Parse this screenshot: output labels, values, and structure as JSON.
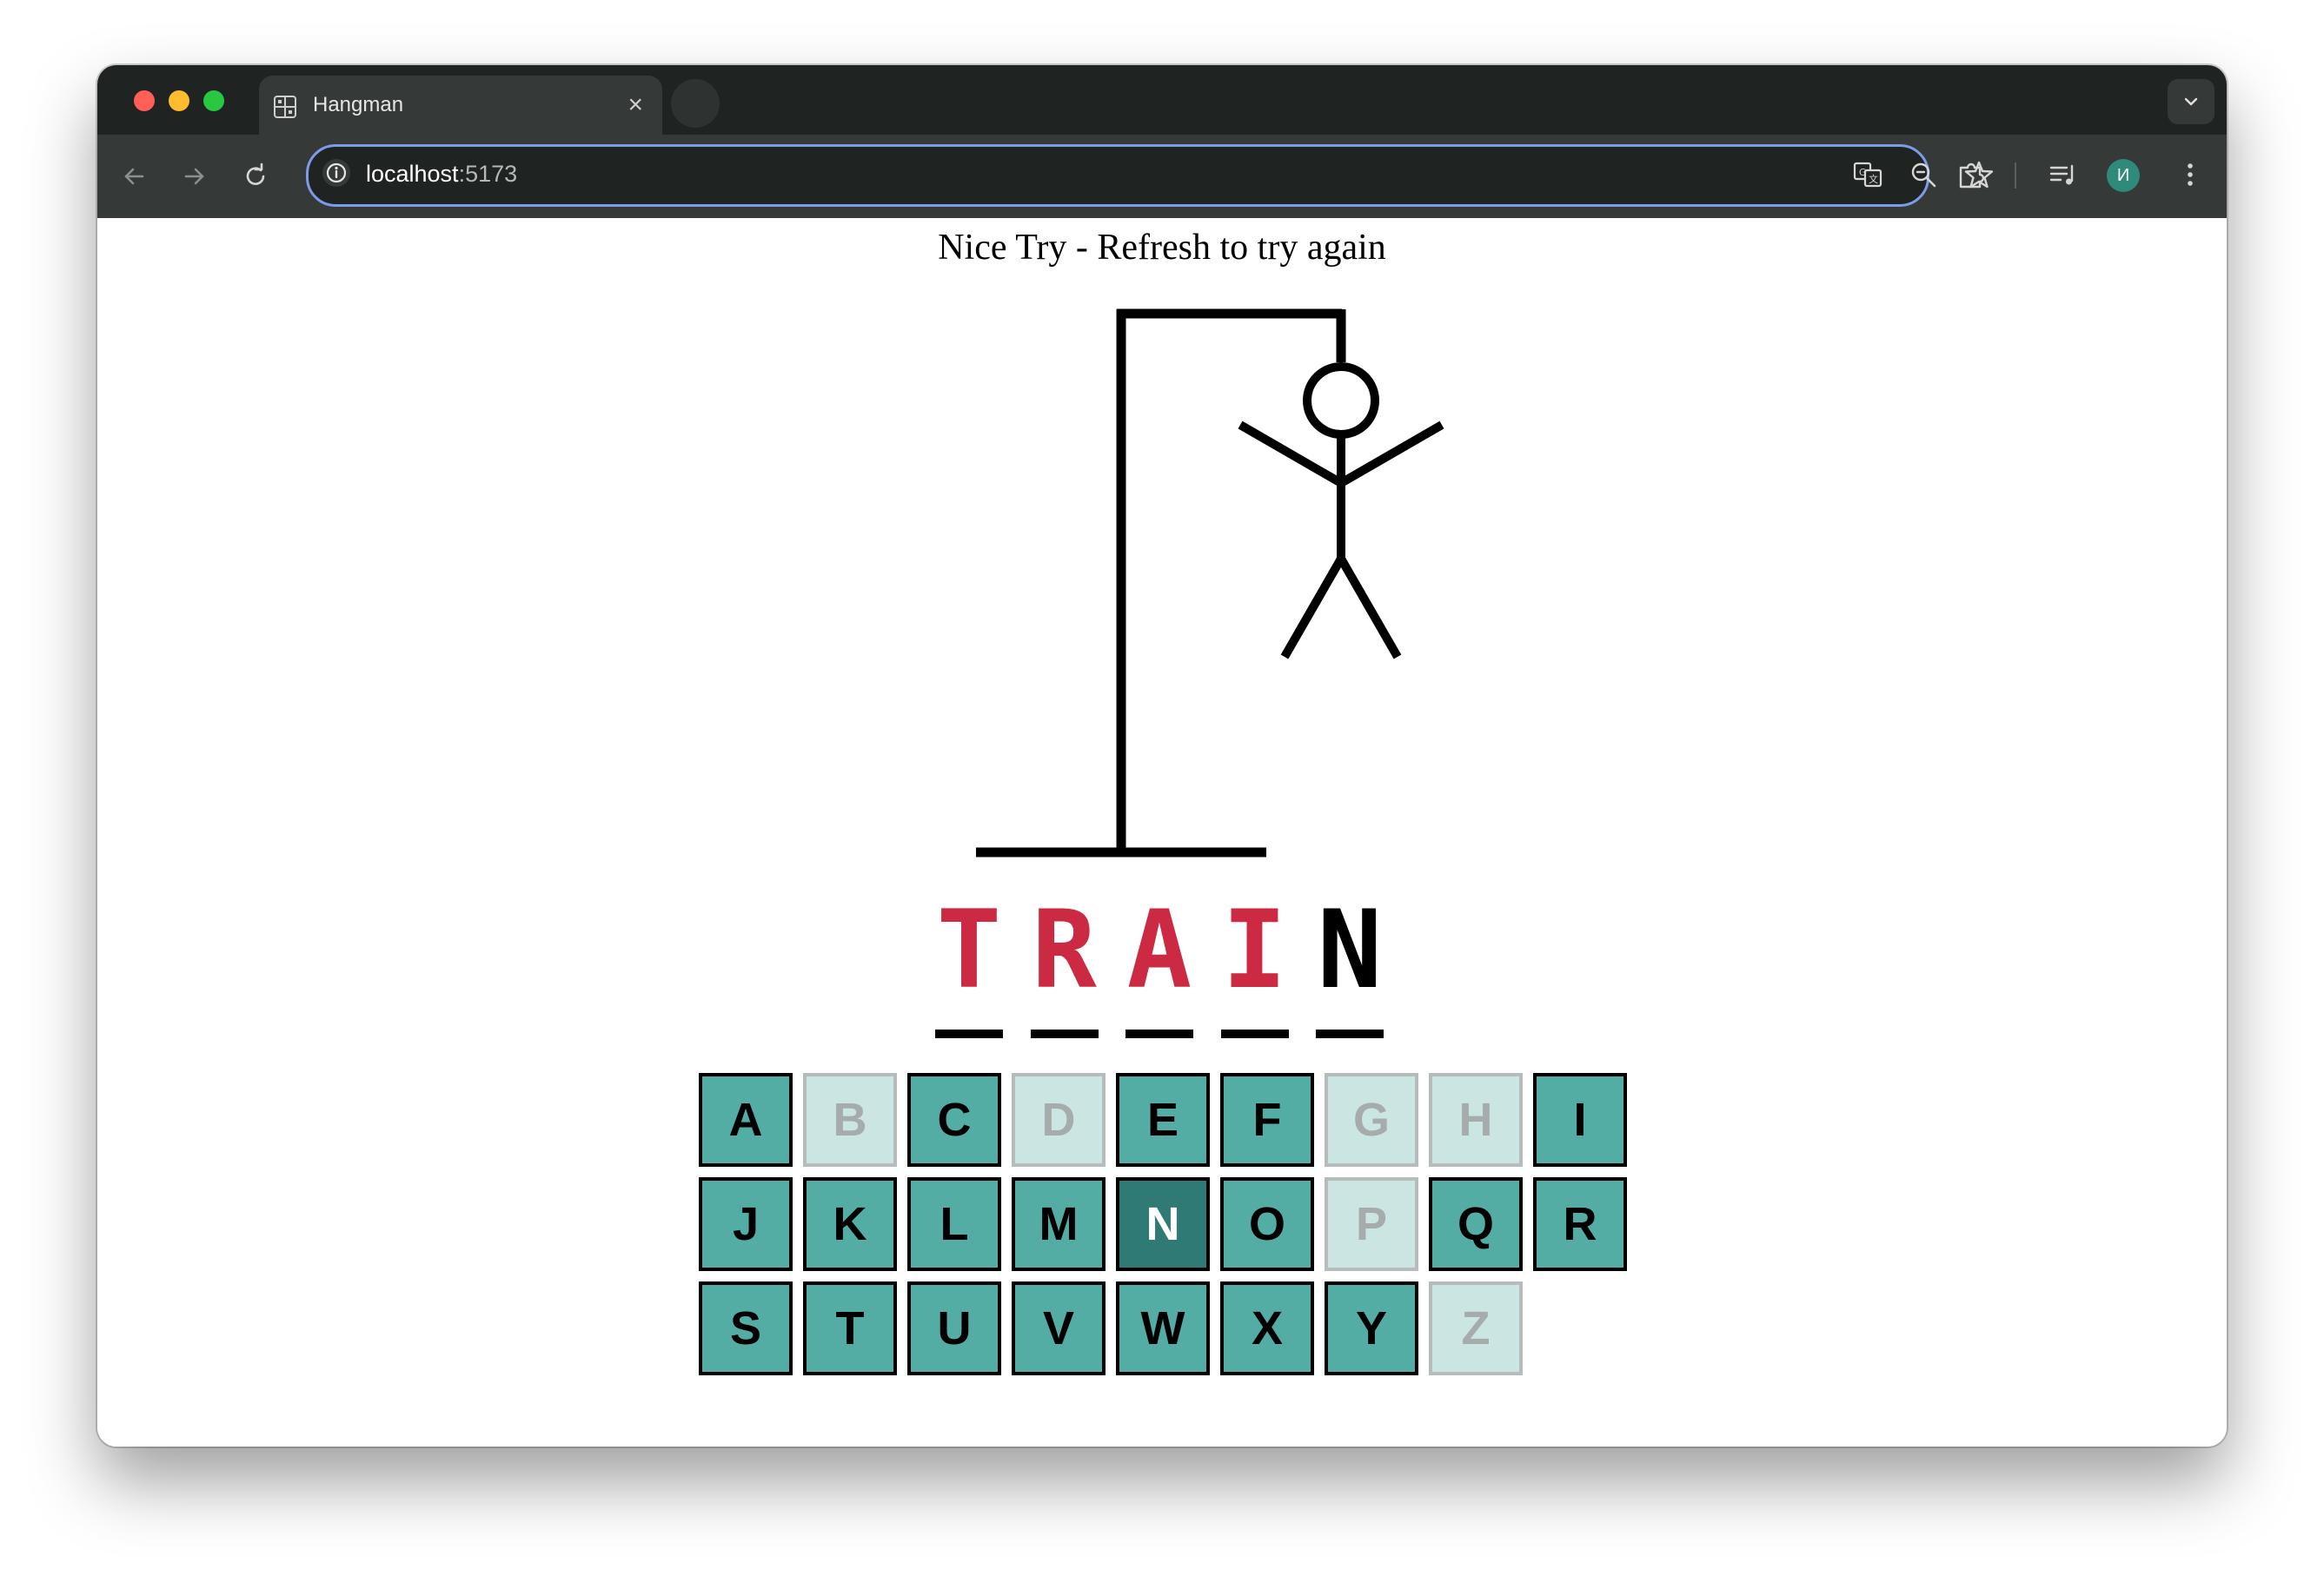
{
  "browser": {
    "tab_title": "Hangman",
    "url_host": "localhost",
    "url_port": ":5173",
    "avatar_initial": "И",
    "accent_color": "#7c9be8"
  },
  "game": {
    "message": "Nice Try - Refresh to try again",
    "wrong_guesses_shown": 6,
    "word": [
      {
        "char": "T",
        "state": "missed"
      },
      {
        "char": "R",
        "state": "missed"
      },
      {
        "char": "A",
        "state": "missed"
      },
      {
        "char": "I",
        "state": "missed"
      },
      {
        "char": "N",
        "state": "guessed"
      }
    ],
    "missed_color": "#cc2a43",
    "keyboard": [
      {
        "key": "A",
        "state": "available"
      },
      {
        "key": "B",
        "state": "disabled"
      },
      {
        "key": "C",
        "state": "available"
      },
      {
        "key": "D",
        "state": "disabled"
      },
      {
        "key": "E",
        "state": "available"
      },
      {
        "key": "F",
        "state": "available"
      },
      {
        "key": "G",
        "state": "disabled"
      },
      {
        "key": "H",
        "state": "disabled"
      },
      {
        "key": "I",
        "state": "available"
      },
      {
        "key": "J",
        "state": "available"
      },
      {
        "key": "K",
        "state": "available"
      },
      {
        "key": "L",
        "state": "available"
      },
      {
        "key": "M",
        "state": "available"
      },
      {
        "key": "N",
        "state": "active"
      },
      {
        "key": "O",
        "state": "available"
      },
      {
        "key": "P",
        "state": "disabled"
      },
      {
        "key": "Q",
        "state": "available"
      },
      {
        "key": "R",
        "state": "available"
      },
      {
        "key": "S",
        "state": "available"
      },
      {
        "key": "T",
        "state": "available"
      },
      {
        "key": "U",
        "state": "available"
      },
      {
        "key": "V",
        "state": "available"
      },
      {
        "key": "W",
        "state": "available"
      },
      {
        "key": "X",
        "state": "available"
      },
      {
        "key": "Y",
        "state": "available"
      },
      {
        "key": "Z",
        "state": "disabled"
      }
    ],
    "key_color": "#53ada5",
    "key_disabled_color": "#cbe5e3",
    "key_active_color": "#2f7a75"
  },
  "icons": {
    "tab_favicon": "grid-favicon-icon",
    "back": "arrow-left-icon",
    "forward": "arrow-right-icon",
    "reload": "reload-icon",
    "site_info": "info-icon",
    "translate": "translate-icon",
    "zoom": "zoom-icon",
    "bookmark": "star-icon",
    "extensions": "puzzle-icon",
    "media": "playlist-icon",
    "menu": "kebab-menu-icon",
    "tab_search": "chevron-down-icon",
    "close_tab": "close-icon"
  }
}
